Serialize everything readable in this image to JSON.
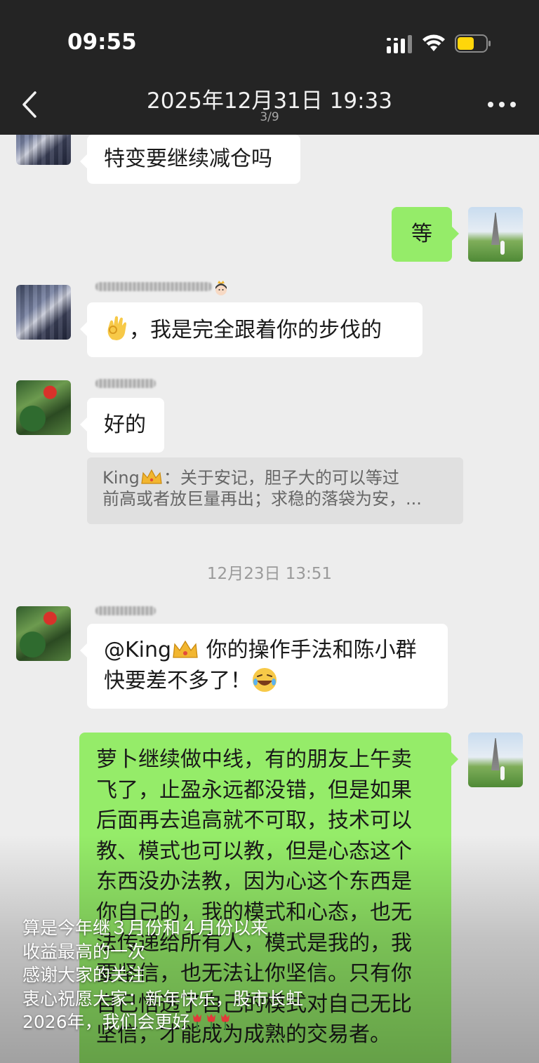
{
  "status_bar": {
    "time": "09:55"
  },
  "header": {
    "title": "2025年12月31日 19:33",
    "page_indicator": "3/9"
  },
  "messages": {
    "m1": "特变要继续减仓吗",
    "m2": "等",
    "m3": "，我是完全跟着你的步伐的",
    "m4": "好的",
    "quote_line1_rest": "：关于安记，胆子大的可以等过",
    "quote_line1_name": "King",
    "quote_line2": "前高或者放巨量再出；求稳的落袋为安，...",
    "timestamp": "12月23日 13:51",
    "m5_mention": "@King",
    "m5_line1_rest": " 你的操作手法和陈小群",
    "m5_line2": "快要差不多了！",
    "m6_lines": [
      "萝卜继续做中线，有的朋友上午卖",
      "飞了，止盈永远都没错，但是如果",
      "后面再去追高就不可取，技术可以",
      "教、模式也可以教，但是心态这个",
      "东西没办法教，因为心这个东西是",
      "你自己的，我的模式和心态，也无",
      "法传递给所有人，模式是我的，我",
      "要坚信，也无法让你坚信。只有你",
      "自己悟透了自己的模式对自己无比",
      "坚信，才能成为成熟的交易者。"
    ]
  },
  "caption": {
    "lines": [
      "算是今年继３月份和４月份以来",
      "收益最高的一次",
      "感谢大家的关注",
      "衷心祝愿大家：新年快乐，股市长虹",
      "2026年，我们会更好"
    ]
  },
  "icons": {
    "back": "chevron-left-icon",
    "more": "more-dots-icon",
    "signal": "signal-icon",
    "wifi": "wifi-icon",
    "battery": "battery-icon"
  },
  "colors": {
    "my_bubble": "#95ec69",
    "background": "#ededed",
    "header": "#242424",
    "battery_fill": "#ffd60a"
  }
}
